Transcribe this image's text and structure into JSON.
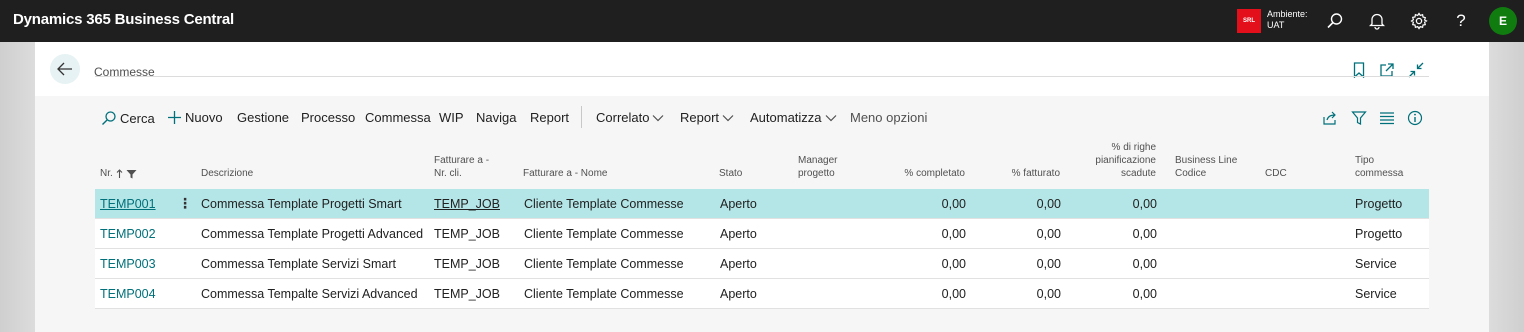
{
  "app": {
    "title": "Dynamics 365 Business Central",
    "env_badge": "SRL",
    "env_label": "Ambiente:",
    "env_value": "UAT",
    "avatar_initial": "E",
    "brand_color": "#1f1f1f",
    "avatar_color": "#107c10"
  },
  "page": {
    "title": "Commesse"
  },
  "actions": {
    "search": "Cerca",
    "new": "Nuovo",
    "manage": "Gestione",
    "process": "Processo",
    "job": "Commessa",
    "wip": "WIP",
    "navigate": "Naviga",
    "report": "Report",
    "related": "Correlato",
    "report_menu": "Report",
    "automate": "Automatizza",
    "fewer_options": "Meno opzioni"
  },
  "table": {
    "headers": {
      "no": "Nr.",
      "description": "Descrizione",
      "bill_to_no_1": "Fatturare a -",
      "bill_to_no_2": "Nr. cli.",
      "bill_to_name": "Fatturare a - Nome",
      "status": "Stato",
      "manager_1": "Manager",
      "manager_2": "progetto",
      "pct_completed": "% completato",
      "pct_invoiced": "% fatturato",
      "pct_overdue_1": "% di righe",
      "pct_overdue_2": "pianificazione",
      "pct_overdue_3": "scadute",
      "business_line_1": "Business Line",
      "business_line_2": "Codice",
      "cdc": "CDC",
      "job_type_1": "Tipo",
      "job_type_2": "commessa"
    },
    "rows": [
      {
        "no": "TEMP001",
        "description": "Commessa Template Progetti Smart",
        "bill_to_no": "TEMP_JOB",
        "bill_to_name": "Cliente Template Commesse",
        "status": "Aperto",
        "manager": "",
        "pct_completed": "0,00",
        "pct_invoiced": "0,00",
        "pct_overdue": "0,00",
        "business_line": "",
        "cdc": "",
        "job_type": "Progetto"
      },
      {
        "no": "TEMP002",
        "description": "Commessa Template Progetti Advanced",
        "bill_to_no": "TEMP_JOB",
        "bill_to_name": "Cliente Template Commesse",
        "status": "Aperto",
        "manager": "",
        "pct_completed": "0,00",
        "pct_invoiced": "0,00",
        "pct_overdue": "0,00",
        "business_line": "",
        "cdc": "",
        "job_type": "Progetto"
      },
      {
        "no": "TEMP003",
        "description": "Commessa Template Servizi Smart",
        "bill_to_no": "TEMP_JOB",
        "bill_to_name": "Cliente Template Commesse",
        "status": "Aperto",
        "manager": "",
        "pct_completed": "0,00",
        "pct_invoiced": "0,00",
        "pct_overdue": "0,00",
        "business_line": "",
        "cdc": "",
        "job_type": "Service"
      },
      {
        "no": "TEMP004",
        "description": "Commessa Tempalte Servizi Advanced",
        "bill_to_no": "TEMP_JOB",
        "bill_to_name": "Cliente Template Commesse",
        "status": "Aperto",
        "manager": "",
        "pct_completed": "0,00",
        "pct_invoiced": "0,00",
        "pct_overdue": "0,00",
        "business_line": "",
        "cdc": "",
        "job_type": "Service"
      }
    ]
  }
}
